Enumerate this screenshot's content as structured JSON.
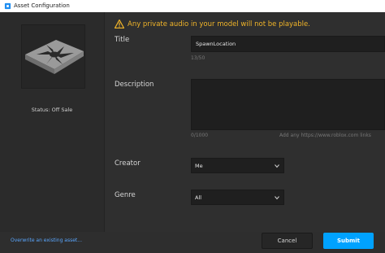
{
  "window": {
    "title": "Asset Configuration"
  },
  "left": {
    "status": "Status: Off Sale"
  },
  "warning": {
    "text": "Any private audio in your model will not be playable."
  },
  "form": {
    "title_label": "Title",
    "title_value": "SpawnLocation",
    "title_count": "13/50",
    "description_label": "Description",
    "description_value": "",
    "description_count": "0/1000",
    "description_hint": "Add any https://www.roblox.com links",
    "creator_label": "Creator",
    "creator_value": "Me",
    "genre_label": "Genre",
    "genre_value": "All"
  },
  "footer": {
    "overwrite_link": "Overwrite an existing asset...",
    "cancel_label": "Cancel",
    "submit_label": "Submit"
  },
  "colors": {
    "accent": "#00a2ff",
    "warning": "#f0b429",
    "link": "#5aa7ff"
  },
  "icons": {
    "app": "roblox-studio-icon",
    "warning": "warning-triangle-icon",
    "dropdown": "chevron-down-icon"
  }
}
